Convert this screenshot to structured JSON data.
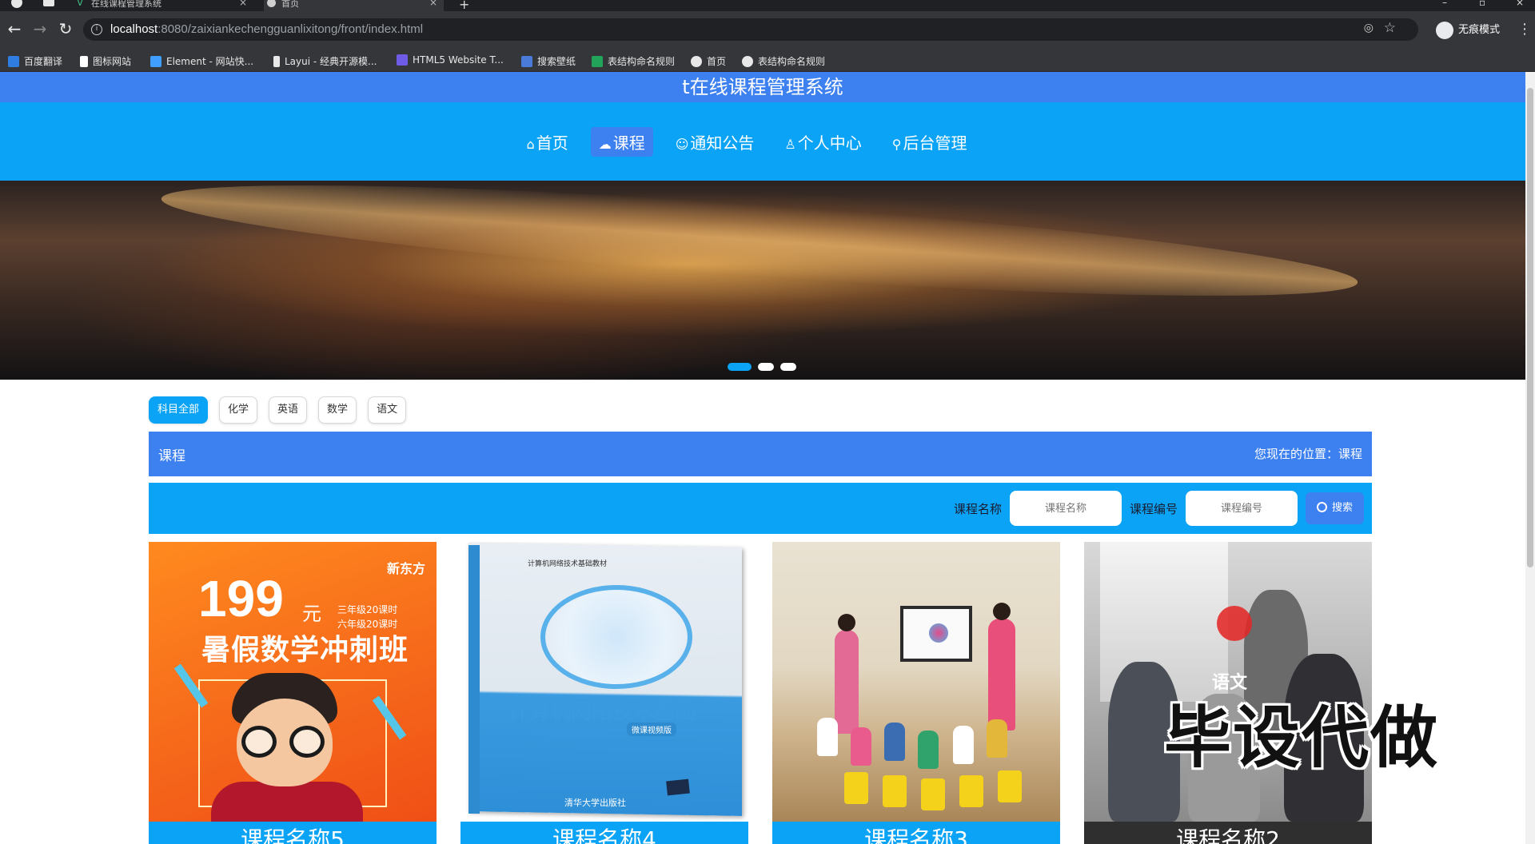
{
  "browser": {
    "tabs": [
      {
        "title": "在线课程管理系统"
      },
      {
        "title": "首页"
      }
    ],
    "new_tab": "+",
    "url_host": "localhost",
    "url_rest": ":8080/zaixiankechengguanlixitong/front/index.html",
    "incognito_label": "无痕模式",
    "bookmarks": [
      {
        "label": "百度翻译",
        "color": "#2f7de1"
      },
      {
        "label": "图标网站",
        "color": "#ffffff"
      },
      {
        "label": "Element - 网站快...",
        "color": "#409eff"
      },
      {
        "label": "Layui - 经典开源模...",
        "color": "#e8e8e8"
      },
      {
        "label": "HTML5 Website T...",
        "color": "#6e5ce6"
      },
      {
        "label": "搜索壁纸",
        "color": "#4a7bd9"
      },
      {
        "label": "表结构命名规则",
        "color": "#22a55b"
      },
      {
        "label": "首页",
        "color": "#e8e8e8"
      },
      {
        "label": "表结构命名规则",
        "color": "#e8e8e8"
      }
    ]
  },
  "site": {
    "title": "t在线课程管理系统",
    "nav": [
      {
        "label": "首页",
        "icon": "home-icon",
        "glyph": "⌂"
      },
      {
        "label": "课程",
        "icon": "course-icon",
        "glyph": "☁",
        "active": true
      },
      {
        "label": "通知公告",
        "icon": "notice-icon",
        "glyph": "☺"
      },
      {
        "label": "个人中心",
        "icon": "user-icon",
        "glyph": "♙"
      },
      {
        "label": "后台管理",
        "icon": "link-icon",
        "glyph": "⚲"
      }
    ],
    "banner_slides": 3,
    "banner_active": 1
  },
  "filters": [
    "科目全部",
    "化学",
    "英语",
    "数学",
    "语文"
  ],
  "section": {
    "title": "课程",
    "location": "您现在的位置：课程"
  },
  "search": {
    "name_label": "课程名称",
    "name_placeholder": "课程名称",
    "code_label": "课程编号",
    "code_placeholder": "课程编号",
    "button": "搜索"
  },
  "courses": [
    {
      "name": "课程名称5",
      "poster": {
        "price": "199",
        "unit": "元",
        "brand": "新东方",
        "note1": "三年级20课时",
        "note2": "六年级20课时",
        "headline": "暑假数学冲刺班"
      }
    },
    {
      "name": "课程名称4",
      "poster": {
        "top_note": "计算机网络技术基础教材",
        "title": "计算机网络技术基础",
        "sub": "微课视频版",
        "publisher": "清华大学出版社"
      }
    },
    {
      "name": "课程名称3"
    },
    {
      "name": "课程名称2",
      "poster": {
        "tag": "语文"
      }
    }
  ],
  "watermark": "毕设代做"
}
